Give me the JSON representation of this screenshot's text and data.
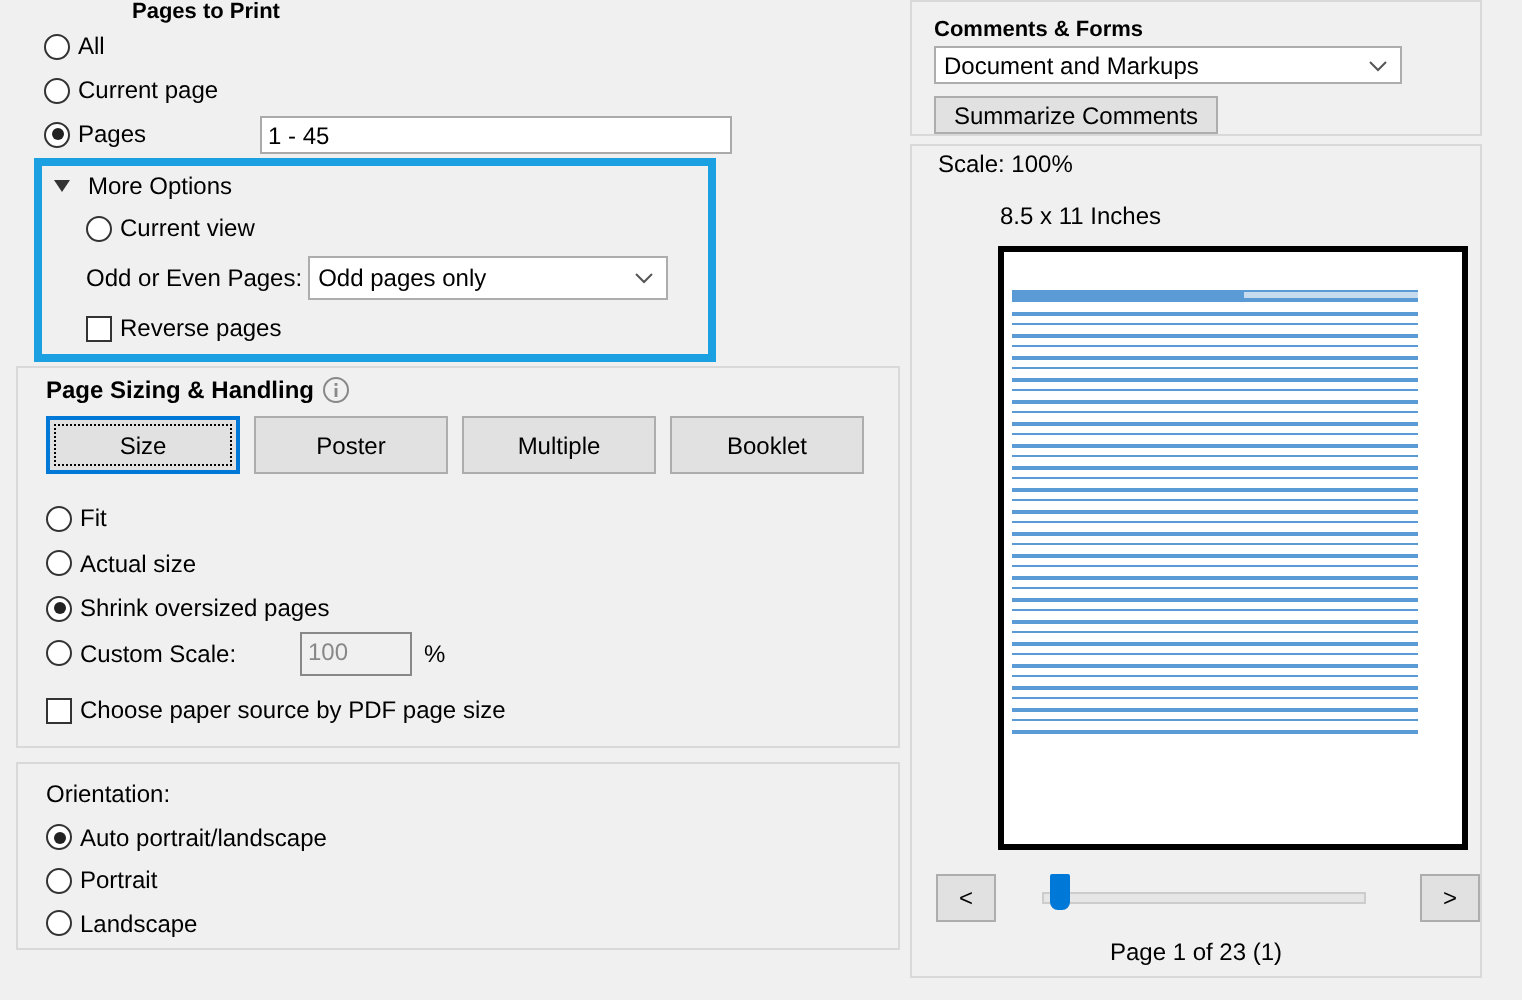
{
  "pages_to_print": {
    "title": "Pages to Print",
    "options": [
      {
        "label": "All",
        "selected": false
      },
      {
        "label": "Current page",
        "selected": false
      },
      {
        "label": "Pages",
        "selected": true
      }
    ],
    "pages_field": {
      "value": "1 - 45"
    }
  },
  "more_options": {
    "label": "More Options",
    "expanded": true,
    "current_view": {
      "label": "Current view",
      "selected": false
    },
    "odd_even": {
      "label": "Odd or Even Pages:",
      "value": "Odd pages only"
    },
    "reverse_pages": {
      "label": "Reverse pages",
      "checked": false
    }
  },
  "page_sizing": {
    "title": "Page Sizing & Handling",
    "modes": [
      {
        "label": "Size",
        "selected": true
      },
      {
        "label": "Poster",
        "selected": false
      },
      {
        "label": "Multiple",
        "selected": false
      },
      {
        "label": "Booklet",
        "selected": false
      }
    ],
    "options": [
      {
        "label": "Fit",
        "selected": false
      },
      {
        "label": "Actual size",
        "selected": false
      },
      {
        "label": "Shrink oversized pages",
        "selected": true
      },
      {
        "label": "Custom Scale:",
        "selected": false
      }
    ],
    "custom_scale": {
      "value": "100",
      "unit": "%",
      "disabled": true
    },
    "paper_source": {
      "label": "Choose paper source by PDF page size",
      "checked": false
    }
  },
  "orientation": {
    "title": "Orientation:",
    "options": [
      {
        "label": "Auto portrait/landscape",
        "selected": true
      },
      {
        "label": "Portrait",
        "selected": false
      },
      {
        "label": "Landscape",
        "selected": false
      }
    ]
  },
  "comments_forms": {
    "title": "Comments & Forms",
    "value": "Document and Markups",
    "button": "Summarize Comments"
  },
  "preview": {
    "scale": "Scale: 100%",
    "paper_size": "8.5 x 11 Inches",
    "prev": "<",
    "next": ">",
    "slider": {
      "level": 0.05
    },
    "page_label": "Page 1 of 23 (1)"
  }
}
